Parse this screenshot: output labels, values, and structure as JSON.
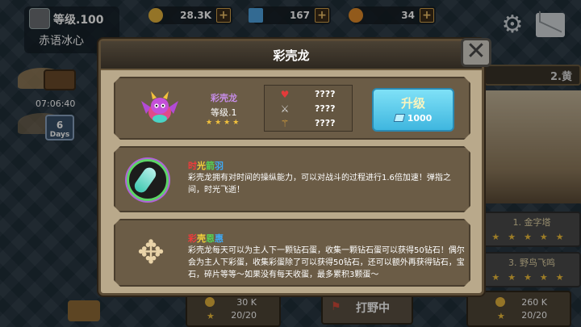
{
  "player": {
    "level": "等级.100",
    "name": "赤语冰心",
    "timer": "07:06:40",
    "days_badge": "Days",
    "days_number": "6"
  },
  "resources": [
    {
      "name": "gold",
      "value": "28.3K",
      "icon": "coin-icon",
      "color": "#e4b23d"
    },
    {
      "name": "gem",
      "value": "167",
      "icon": "gem-icon",
      "color": "#4fa3e0"
    },
    {
      "name": "coin",
      "value": "34",
      "icon": "coin-icon",
      "color": "#e08a2a"
    }
  ],
  "background": {
    "right_tab": "2.黄",
    "map_items": [
      {
        "label": "1. 金字塔",
        "stars": "★★★★★"
      },
      {
        "label": "3. 野鸟飞鸣",
        "stars": "★★★★★"
      }
    ],
    "bottom_left": {
      "gold": "30 K",
      "stars": "20/20"
    },
    "bottom_right": {
      "gold": "260 K",
      "stars": "20/20"
    },
    "wild_button": "打野中"
  },
  "modal": {
    "title": "彩壳龙",
    "hero": {
      "name": "彩壳龙",
      "level": "等级.1",
      "stars": "★★★★",
      "stats": [
        {
          "icon": "heart-icon",
          "value": "????",
          "color": "#e43a3a"
        },
        {
          "icon": "sword-icon",
          "value": "????",
          "color": "#d8d8d8"
        },
        {
          "icon": "staff-icon",
          "value": "????",
          "color": "#e4a83a"
        }
      ]
    },
    "upgrade": {
      "label": "升级",
      "cost": "1000"
    },
    "skills": [
      {
        "title_chars": [
          "时",
          "光",
          "箭",
          "羽"
        ],
        "description": "彩壳龙拥有对时间的操纵能力，可以对战斗的过程进行1.6倍加速！弹指之间，时光飞逝！"
      },
      {
        "title_chars": [
          "彩",
          "壳",
          "恩",
          "惠"
        ],
        "description": "彩壳龙每天可以为主人下一颗钻石蛋，收集一颗钻石蛋可以获得50钻石！偶尔会为主人下彩蛋，收集彩蛋除了可以获得50钻石，还可以额外再获得钻石，宝石，碎片等等～如果没有每天收蛋，最多累积3颗蛋～"
      }
    ],
    "close_label": "✕"
  }
}
